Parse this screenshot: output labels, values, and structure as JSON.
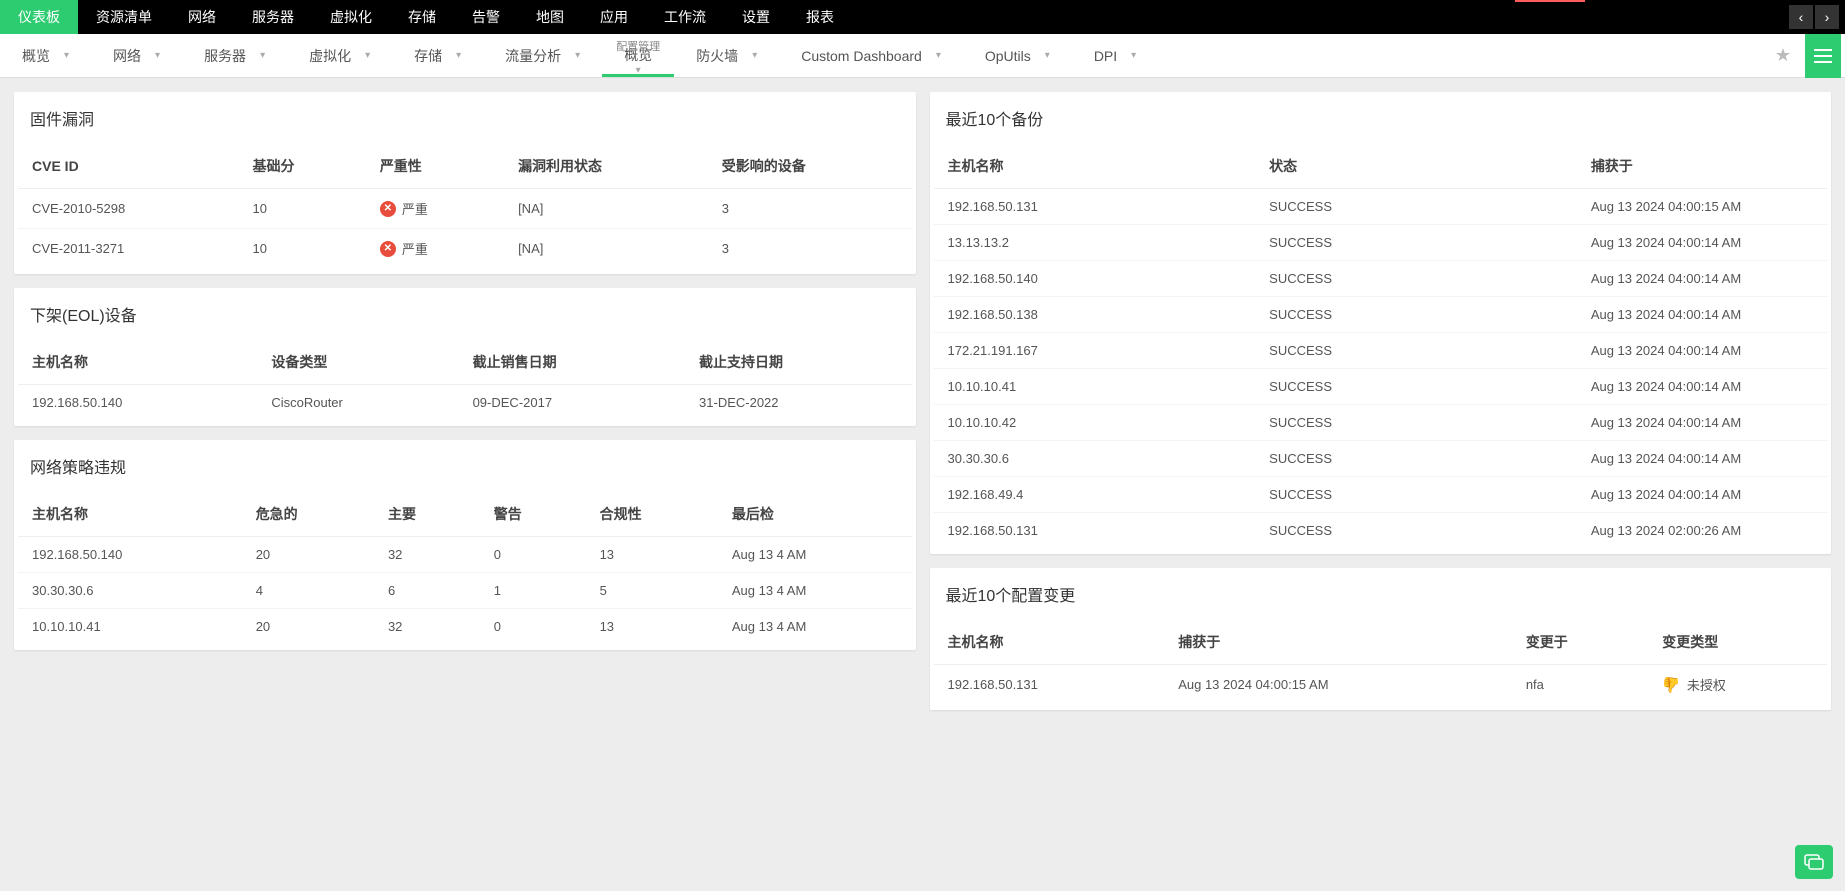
{
  "topnav": {
    "items": [
      "仪表板",
      "资源清单",
      "网络",
      "服务器",
      "虚拟化",
      "存储",
      "告警",
      "地图",
      "应用",
      "工作流",
      "设置",
      "报表"
    ],
    "activeIndex": 0
  },
  "subnav": {
    "items": [
      {
        "label": "概览",
        "chev": true
      },
      {
        "label": "网络",
        "chev": true
      },
      {
        "label": "服务器",
        "chev": true
      },
      {
        "label": "虚拟化",
        "chev": true
      },
      {
        "label": "存储",
        "chev": true
      },
      {
        "label": "流量分析",
        "chev": true
      },
      {
        "label": "概览",
        "small": "配置管理",
        "chev": true,
        "active": true
      },
      {
        "label": "防火墙",
        "chev": true
      },
      {
        "label": "Custom Dashboard",
        "chev": true
      },
      {
        "label": "OpUtils",
        "chev": true
      },
      {
        "label": "DPI",
        "chev": true
      }
    ]
  },
  "panels": {
    "firmware": {
      "title": "固件漏洞",
      "headers": [
        "CVE ID",
        "基础分",
        "严重性",
        "漏洞利用状态",
        "受影响的设备"
      ],
      "rows": [
        {
          "cve": "CVE-2010-5298",
          "score": "10",
          "sev": "严重",
          "exploit": "[NA]",
          "affected": "3"
        },
        {
          "cve": "CVE-2011-3271",
          "score": "10",
          "sev": "严重",
          "exploit": "[NA]",
          "affected": "3"
        }
      ]
    },
    "eol": {
      "title": "下架(EOL)设备",
      "headers": [
        "主机名称",
        "设备类型",
        "截止销售日期",
        "截止支持日期"
      ],
      "rows": [
        {
          "host": "192.168.50.140",
          "type": "CiscoRouter",
          "eos": "09-DEC-2017",
          "eosup": "31-DEC-2022"
        }
      ]
    },
    "policy": {
      "title": "网络策略违规",
      "headers": [
        "主机名称",
        "危急的",
        "主要",
        "警告",
        "合规性",
        "最后检"
      ],
      "rows": [
        {
          "host": "192.168.50.140",
          "crit": "20",
          "major": "32",
          "warn": "0",
          "comp": "13",
          "last": "Aug 13 4 AM"
        },
        {
          "host": "30.30.30.6",
          "crit": "4",
          "major": "6",
          "warn": "1",
          "comp": "5",
          "last": "Aug 13 4 AM"
        },
        {
          "host": "10.10.10.41",
          "crit": "20",
          "major": "32",
          "warn": "0",
          "comp": "13",
          "last": "Aug 13 4 AM"
        }
      ]
    },
    "backups": {
      "title": "最近10个备份",
      "headers": [
        "主机名称",
        "状态",
        "捕获于"
      ],
      "rows": [
        {
          "host": "192.168.50.131",
          "status": "SUCCESS",
          "ts": "Aug 13 2024 04:00:15 AM"
        },
        {
          "host": "13.13.13.2",
          "status": "SUCCESS",
          "ts": "Aug 13 2024 04:00:14 AM"
        },
        {
          "host": "192.168.50.140",
          "status": "SUCCESS",
          "ts": "Aug 13 2024 04:00:14 AM"
        },
        {
          "host": "192.168.50.138",
          "status": "SUCCESS",
          "ts": "Aug 13 2024 04:00:14 AM"
        },
        {
          "host": "172.21.191.167",
          "status": "SUCCESS",
          "ts": "Aug 13 2024 04:00:14 AM"
        },
        {
          "host": "10.10.10.41",
          "status": "SUCCESS",
          "ts": "Aug 13 2024 04:00:14 AM"
        },
        {
          "host": "10.10.10.42",
          "status": "SUCCESS",
          "ts": "Aug 13 2024 04:00:14 AM"
        },
        {
          "host": "30.30.30.6",
          "status": "SUCCESS",
          "ts": "Aug 13 2024 04:00:14 AM"
        },
        {
          "host": "192.168.49.4",
          "status": "SUCCESS",
          "ts": "Aug 13 2024 04:00:14 AM"
        },
        {
          "host": "192.168.50.131",
          "status": "SUCCESS",
          "ts": "Aug 13 2024 02:00:26 AM"
        }
      ]
    },
    "changes": {
      "title": "最近10个配置变更",
      "headers": [
        "主机名称",
        "捕获于",
        "变更于",
        "变更类型"
      ],
      "rows": [
        {
          "host": "192.168.50.131",
          "captured": "Aug 13 2024 04:00:15 AM",
          "changedby": "nfa",
          "ctype": "未授权"
        }
      ]
    }
  }
}
